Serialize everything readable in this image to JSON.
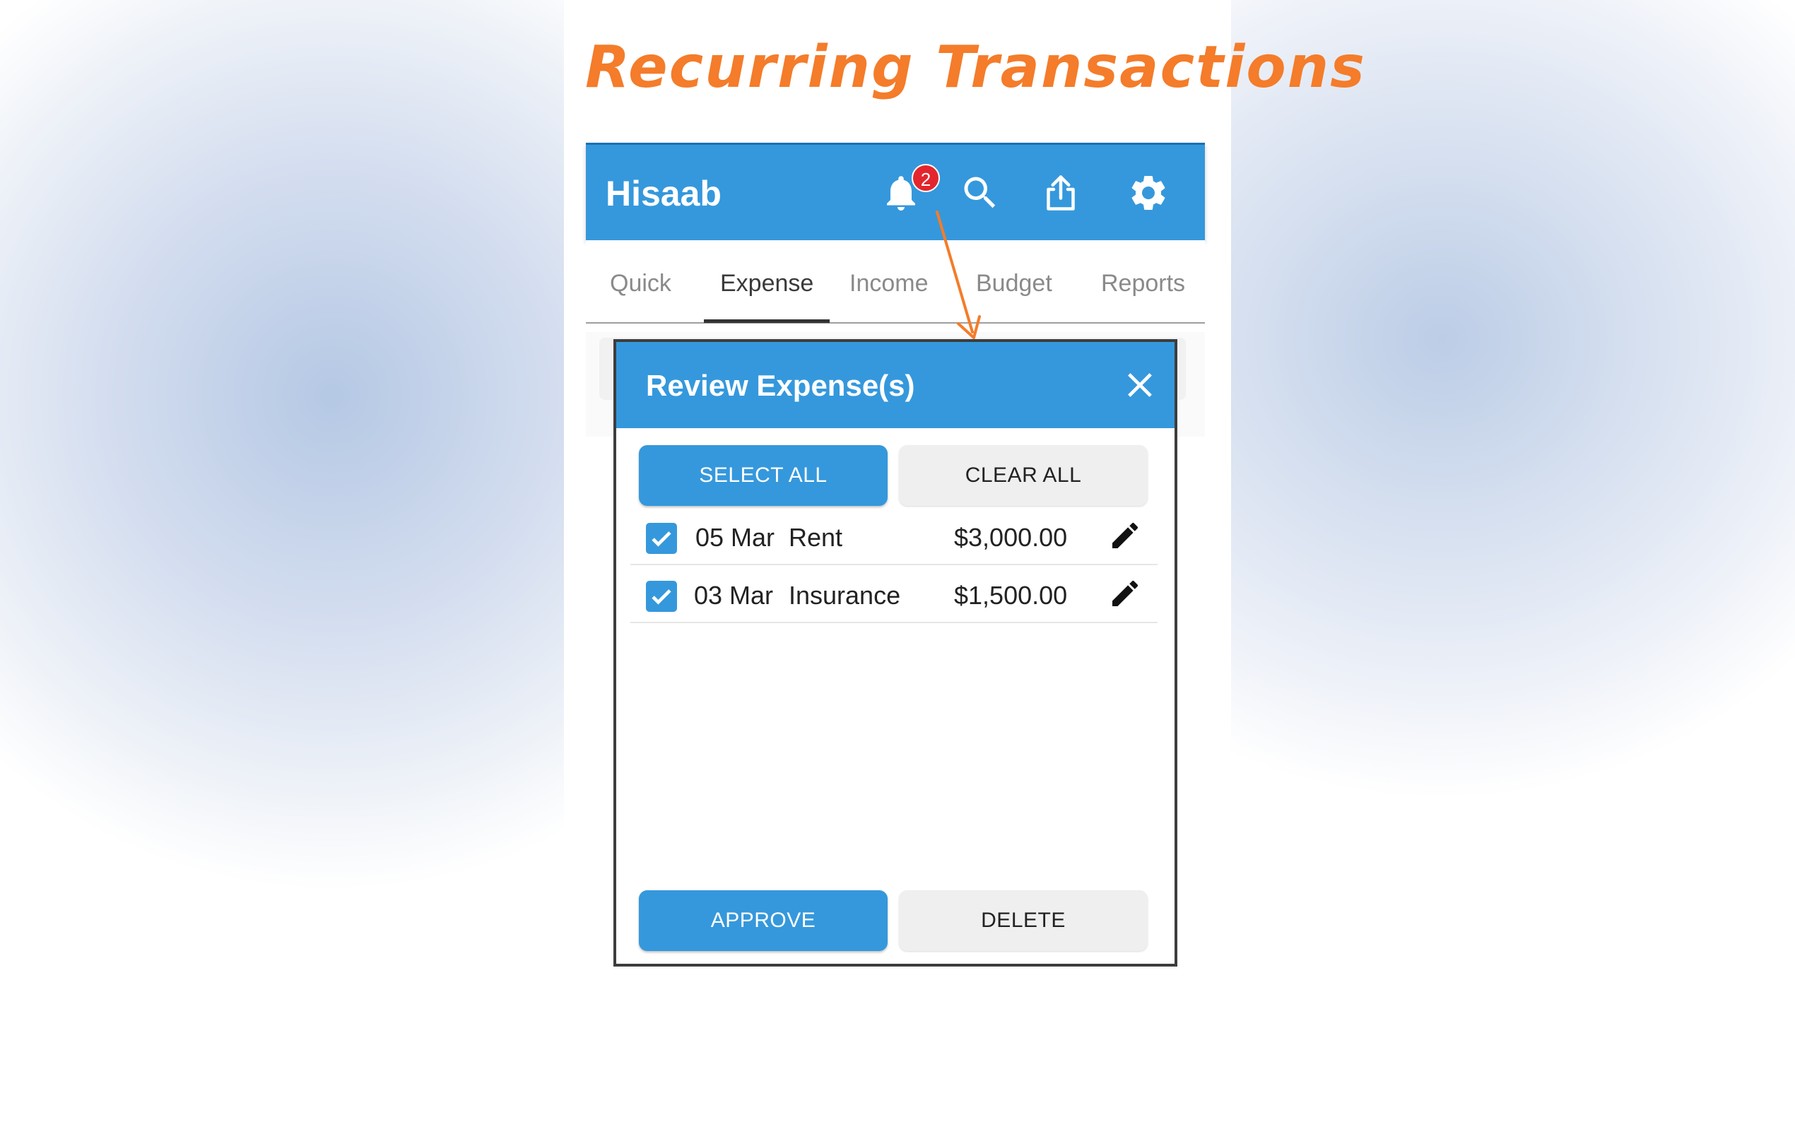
{
  "headline": "Recurring Transactions",
  "app": {
    "title": "Hisaab",
    "notification_count": "2",
    "icons": [
      "bell-icon",
      "search-icon",
      "share-icon",
      "gear-icon"
    ]
  },
  "tabs": [
    {
      "label": "Quick"
    },
    {
      "label": "Expense",
      "active": true
    },
    {
      "label": "Income"
    },
    {
      "label": "Budget"
    },
    {
      "label": "Reports"
    }
  ],
  "dialog": {
    "title": "Review Expense(s)",
    "select_all_label": "SELECT ALL",
    "clear_all_label": "CLEAR ALL",
    "approve_label": "APPROVE",
    "delete_label": "DELETE",
    "rows": [
      {
        "date": "05 Mar",
        "name": "Rent",
        "amount": "$3,000.00",
        "checked": true
      },
      {
        "date": "03 Mar",
        "name": "Insurance",
        "amount": "$1,500.00",
        "checked": true
      }
    ]
  },
  "colors": {
    "primary": "#3598dc",
    "accent_orange": "#f47c2a",
    "badge_red": "#e3262d"
  }
}
